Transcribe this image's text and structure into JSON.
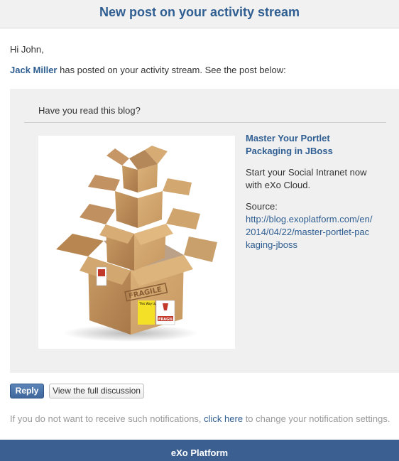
{
  "email": {
    "header_title": "New post on your activity stream",
    "greeting": "Hi John,",
    "poster_name": "Jack Miller",
    "intro_text": " has posted on your activity stream. See the post below:"
  },
  "post": {
    "message": "Have you read this blog?",
    "preview": {
      "title": "Master Your Portlet Packaging in JBoss",
      "description": "Start your Social Intranet now with eXo Cloud.",
      "source_label": "Source:",
      "source_url": "http://blog.exoplatform.com/en/2014/04/22/master-portlet-packaging-jboss",
      "image_alt": "cardboard-boxes-image",
      "image_labels": {
        "fragile_stamp": "FRAGILE",
        "fragile_sticker": "FRAGILE",
        "this_way_up": "This Way Up"
      }
    }
  },
  "actions": {
    "reply_label": "Reply",
    "view_discussion_label": "View the full discussion"
  },
  "notification": {
    "text_before": "If you do not want to receive such notifications, ",
    "link_text": "click here",
    "text_after": " to change your notification settings."
  },
  "footer": {
    "brand": "eXo Platform"
  },
  "colors": {
    "title_blue": "#2f5e92",
    "footer_blue": "#3c5f91",
    "muted_gray": "#999999",
    "post_bg": "#f0f0f0"
  }
}
